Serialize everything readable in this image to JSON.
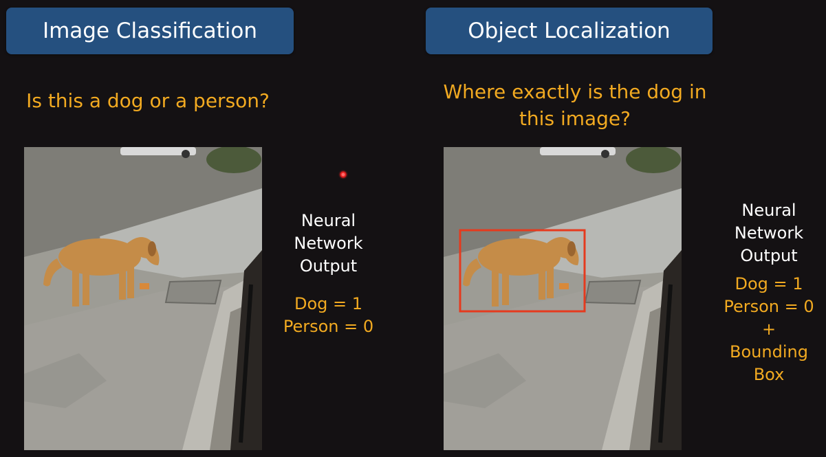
{
  "left_panel": {
    "title": "Image Classification",
    "question": "Is this a dog or a person?",
    "output": {
      "label_lines": [
        "Neural",
        "Network",
        "Output"
      ],
      "dog": "Dog = 1",
      "person": "Person = 0"
    }
  },
  "right_panel": {
    "title": "Object Localization",
    "question_lines": [
      "Where exactly is the dog in",
      "this image?"
    ],
    "output": {
      "label_lines": [
        "Neural",
        "Network",
        "Output"
      ],
      "dog": "Dog = 1",
      "person": "Person = 0",
      "plus": "+",
      "box_lines": [
        "Bounding",
        "Box"
      ]
    }
  },
  "colors": {
    "background": "#141113",
    "pill": "#25507f",
    "question_text": "#f2aa21",
    "bounding_box": "#e53a1e",
    "laser_pointer": "#e31d1d"
  }
}
